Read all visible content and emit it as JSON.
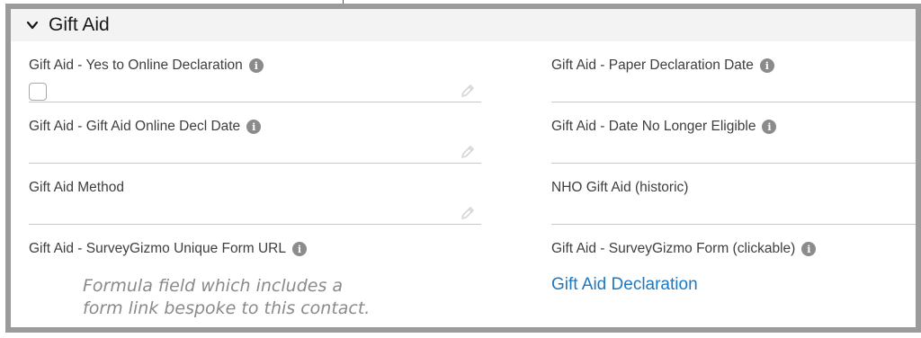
{
  "section": {
    "title": "Gift Aid",
    "chevron_icon": "chevron-down-icon"
  },
  "fields": {
    "yes_online_declaration": {
      "label": "Gift Aid - Yes to Online Declaration",
      "value": false
    },
    "paper_declaration_date": {
      "label": "Gift Aid - Paper Declaration Date",
      "value": ""
    },
    "online_decl_date": {
      "label": "Gift Aid - Gift Aid Online Decl Date",
      "value": ""
    },
    "date_no_longer_eligible": {
      "label": "Gift Aid - Date No Longer Eligible",
      "value": ""
    },
    "method": {
      "label": "Gift Aid Method",
      "value": ""
    },
    "nho_historic": {
      "label": "NHO Gift Aid (historic)",
      "value": ""
    },
    "surveygizmo_url": {
      "label": "Gift Aid - SurveyGizmo Unique Form URL",
      "value": ""
    },
    "surveygizmo_form": {
      "label": "Gift Aid - SurveyGizmo Form (clickable)",
      "value": "Gift Aid Declaration"
    }
  },
  "annotation": "Formula field which includes a form link bespoke to this contact.",
  "info_icon_glyph": "i",
  "colors": {
    "frame": "#9b9b9b",
    "header_bg": "#f3f3f3",
    "link": "#1c78c3",
    "info_icon": "#8b8b8b"
  }
}
